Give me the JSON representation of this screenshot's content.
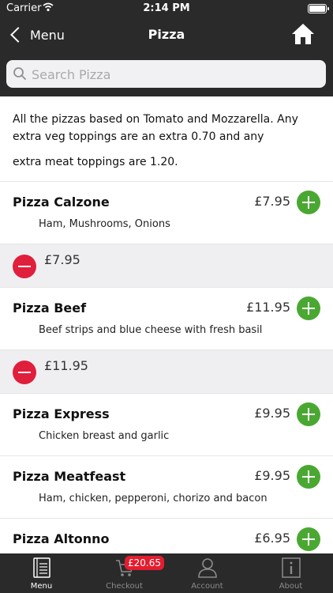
{
  "status_bar": {
    "carrier": "Carrier",
    "time": "2:14 PM"
  },
  "nav": {
    "back_label": "Menu",
    "title": "Pizza"
  },
  "search": {
    "placeholder": "Search Pizza"
  },
  "intro": {
    "line1": "All the pizzas based on Tomato and Mozzarella. Any extra veg toppings are an extra 0.70 and any",
    "line2": "extra meat toppings are 1.20."
  },
  "items": [
    {
      "name": "Pizza Calzone",
      "desc": "Ham, Mushrooms, Onions",
      "price": "£7.95",
      "cart_price": "£7.95"
    },
    {
      "name": "Pizza Beef",
      "desc": "Beef strips and blue cheese with fresh basil",
      "price": "£11.95",
      "cart_price": "£11.95"
    },
    {
      "name": "Pizza Express",
      "desc": "Chicken breast and garlic",
      "price": "£9.95"
    },
    {
      "name": "Pizza Meatfeast",
      "desc": "Ham, chicken, pepperoni, chorizo and bacon",
      "price": "£9.95"
    },
    {
      "name": "Pizza Altonno",
      "desc": "",
      "price": "£6.95"
    }
  ],
  "tabs": [
    {
      "label": "Menu",
      "icon": "menu-book-icon",
      "active": true
    },
    {
      "label": "Checkout",
      "icon": "cart-icon",
      "badge": "£20.65"
    },
    {
      "label": "Account",
      "icon": "person-icon"
    },
    {
      "label": "About",
      "icon": "info-icon"
    }
  ],
  "colors": {
    "bar": "#2a2a2a",
    "add": "#4aa832",
    "remove": "#e01f3c",
    "badge": "#e31d2f"
  }
}
